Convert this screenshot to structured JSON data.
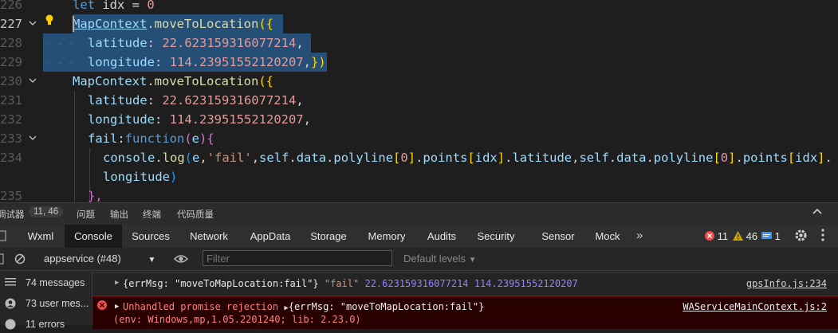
{
  "editor": {
    "lines": [
      {
        "num": "226",
        "tokens": [
          {
            "t": "let ",
            "c": "kw2"
          },
          {
            "t": "idx",
            "c": "pl"
          },
          {
            "t": " = ",
            "c": "pl"
          },
          {
            "t": "0",
            "c": "num"
          }
        ]
      },
      {
        "num": "227",
        "tokens": [
          {
            "t": "MapContext",
            "c": "obj"
          },
          {
            "t": ".",
            "c": "pl"
          },
          {
            "t": "moveToLocation",
            "c": "fn"
          },
          {
            "t": "({",
            "c": "brk"
          }
        ]
      },
      {
        "num": "228",
        "tokens": [
          {
            "t": "latitude",
            "c": "key"
          },
          {
            "t": ": ",
            "c": "pl"
          },
          {
            "t": "22.623159316077214",
            "c": "num"
          },
          {
            "t": ",",
            "c": "pl"
          }
        ]
      },
      {
        "num": "229",
        "tokens": [
          {
            "t": "longitude",
            "c": "key"
          },
          {
            "t": ": ",
            "c": "pl"
          },
          {
            "t": "114.23951552120207",
            "c": "num"
          },
          {
            "t": ",",
            "c": "pl"
          },
          {
            "t": "})",
            "c": "brk"
          }
        ]
      },
      {
        "num": "230",
        "tokens": [
          {
            "t": "MapContext",
            "c": "obj"
          },
          {
            "t": ".",
            "c": "pl"
          },
          {
            "t": "moveToLocation",
            "c": "fn"
          },
          {
            "t": "({",
            "c": "brk"
          }
        ]
      },
      {
        "num": "231",
        "tokens": [
          {
            "t": "latitude",
            "c": "key"
          },
          {
            "t": ": ",
            "c": "pl"
          },
          {
            "t": "22.623159316077214",
            "c": "num"
          },
          {
            "t": ",",
            "c": "pl"
          }
        ]
      },
      {
        "num": "232",
        "tokens": [
          {
            "t": "longitude",
            "c": "key"
          },
          {
            "t": ": ",
            "c": "pl"
          },
          {
            "t": "114.23951552120207",
            "c": "num"
          },
          {
            "t": ",",
            "c": "pl"
          }
        ]
      },
      {
        "num": "233",
        "tokens": [
          {
            "t": "fail",
            "c": "key"
          },
          {
            "t": ":",
            "c": "pl"
          },
          {
            "t": "function",
            "c": "kw2"
          },
          {
            "t": "(",
            "c": "brk2"
          },
          {
            "t": "e",
            "c": "key"
          },
          {
            "t": ")",
            "c": "brk2"
          },
          {
            "t": "{",
            "c": "brk2"
          }
        ]
      },
      {
        "num": "234",
        "tokens": [
          {
            "t": "console",
            "c": "key"
          },
          {
            "t": ".",
            "c": "pl"
          },
          {
            "t": "log",
            "c": "fn"
          },
          {
            "t": "(",
            "c": "brk3"
          },
          {
            "t": "e",
            "c": "key"
          },
          {
            "t": ",",
            "c": "pl"
          },
          {
            "t": "'fail'",
            "c": "str"
          },
          {
            "t": ",",
            "c": "pl"
          },
          {
            "t": "self",
            "c": "key"
          },
          {
            "t": ".",
            "c": "pl"
          },
          {
            "t": "data",
            "c": "key"
          },
          {
            "t": ".",
            "c": "pl"
          },
          {
            "t": "polyline",
            "c": "key"
          },
          {
            "t": "[",
            "c": "brk"
          },
          {
            "t": "0",
            "c": "num"
          },
          {
            "t": "]",
            "c": "brk"
          },
          {
            "t": ".",
            "c": "pl"
          },
          {
            "t": "points",
            "c": "key"
          },
          {
            "t": "[",
            "c": "brk"
          },
          {
            "t": "idx",
            "c": "key"
          },
          {
            "t": "]",
            "c": "brk"
          },
          {
            "t": ".",
            "c": "pl"
          },
          {
            "t": "latitude",
            "c": "key"
          },
          {
            "t": ",",
            "c": "pl"
          },
          {
            "t": "self",
            "c": "key"
          },
          {
            "t": ".",
            "c": "pl"
          },
          {
            "t": "data",
            "c": "key"
          },
          {
            "t": ".",
            "c": "pl"
          },
          {
            "t": "polyline",
            "c": "key"
          },
          {
            "t": "[",
            "c": "brk"
          },
          {
            "t": "0",
            "c": "num"
          },
          {
            "t": "]",
            "c": "brk"
          },
          {
            "t": ".",
            "c": "pl"
          },
          {
            "t": "points",
            "c": "key"
          },
          {
            "t": "[",
            "c": "brk"
          },
          {
            "t": "idx",
            "c": "key"
          },
          {
            "t": "]",
            "c": "brk"
          },
          {
            "t": ".",
            "c": "pl"
          }
        ]
      },
      {
        "num": "",
        "tokens": [
          {
            "t": "longitude",
            "c": "key"
          },
          {
            "t": ")",
            "c": "brk3"
          }
        ]
      },
      {
        "num": "235",
        "tokens": [
          {
            "t": "},",
            "c": "brk2"
          }
        ]
      }
    ]
  },
  "panel_tabs": {
    "debugger": "调试器",
    "debugger_badge": "11, 46",
    "problems": "问题",
    "output": "输出",
    "terminal": "终端",
    "code_quality": "代码质量"
  },
  "devtools_tabs": [
    "Wxml",
    "Console",
    "Sources",
    "Network",
    "AppData",
    "Storage",
    "Memory",
    "Audits",
    "Security",
    "Sensor",
    "Mock"
  ],
  "active_devtools_tab": "Console",
  "counts": {
    "errors": "11",
    "warnings": "46",
    "info": "1"
  },
  "toolbar": {
    "context": "appservice (#48)",
    "filter_placeholder": "Filter",
    "levels": "Default levels"
  },
  "sidebar": {
    "items": [
      {
        "label": "74 messages"
      },
      {
        "label": "73 user mes..."
      },
      {
        "label": "11 errors"
      }
    ]
  },
  "console_rows": {
    "row1_obj": "{errMsg: \"moveToMapLocation:fail\"}",
    "row1_fail": "\"fail\"",
    "row1_nums": "22.623159316077214 114.23951552120207",
    "row1_source": "gpsInfo.js:234",
    "row2_msg": "Unhandled promise rejection",
    "row2_obj": "{errMsg: \"moveToMapLocation:fail\"}",
    "row2_source": "WAServiceMainContext.js:2",
    "row2_env": "(env: Windows,mp,1.05.2201240; lib: 2.23.0)"
  },
  "colors": {
    "error": "#f14c4c",
    "warning": "#cca700",
    "info": "#3794ff",
    "selection": "#264f78"
  }
}
